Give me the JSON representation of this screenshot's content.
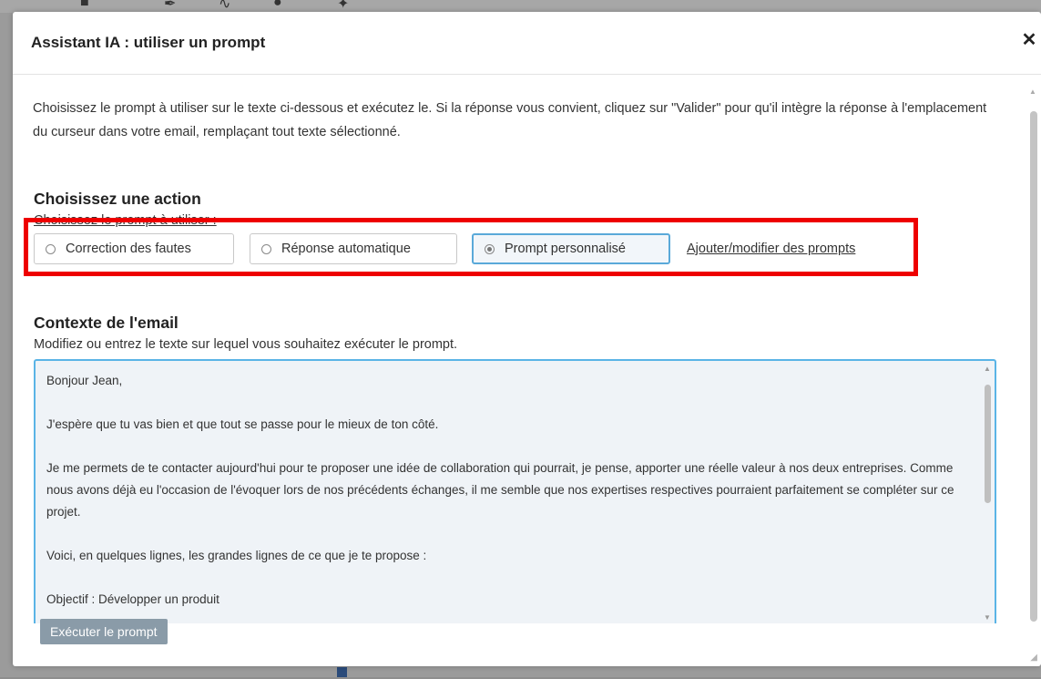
{
  "dialog": {
    "title": "Assistant IA : utiliser un prompt",
    "close_icon": "close-icon",
    "intro": "Choisissez le prompt à utiliser sur le texte ci-dessous et exécutez le. Si la réponse vous convient, cliquez sur \"Valider\" pour qu'il intègre la réponse à l'emplacement du curseur dans votre email, remplaçant tout texte sélectionné.",
    "action_section": {
      "title": "Choisissez une action",
      "subtitle": "Choisissez le prompt à utiliser :",
      "options": [
        {
          "label": "Correction des fautes",
          "selected": false
        },
        {
          "label": "Réponse automatique",
          "selected": false
        },
        {
          "label": "Prompt personnalisé",
          "selected": true
        }
      ],
      "manage_link": "Ajouter/modifier des prompts",
      "highlight_color": "#ee0000"
    },
    "context_section": {
      "title": "Contexte de l'email",
      "subtitle": "Modifiez ou entrez le texte sur lequel vous souhaitez exécuter le prompt.",
      "email_lines": [
        "Bonjour Jean,",
        "J'espère que tu vas bien et que tout se passe pour le mieux de ton côté.",
        "Je me permets de te contacter aujourd'hui pour te proposer une idée de collaboration qui pourrait, je pense, apporter une réelle valeur à nos deux entreprises. Comme nous avons déjà eu l'occasion de l'évoquer lors de nos précédents échanges, il me semble que nos expertises respectives pourraient parfaitement se compléter sur ce projet.",
        "Voici, en quelques lignes, les grandes lignes de ce que je te propose :",
        "Objectif : Développer un produit"
      ]
    },
    "run_button": "Exécuter le prompt"
  },
  "colors": {
    "accent_border": "#5ab4e6",
    "button_bg": "#8a9ba8",
    "overlay": "#9b9b9b"
  }
}
